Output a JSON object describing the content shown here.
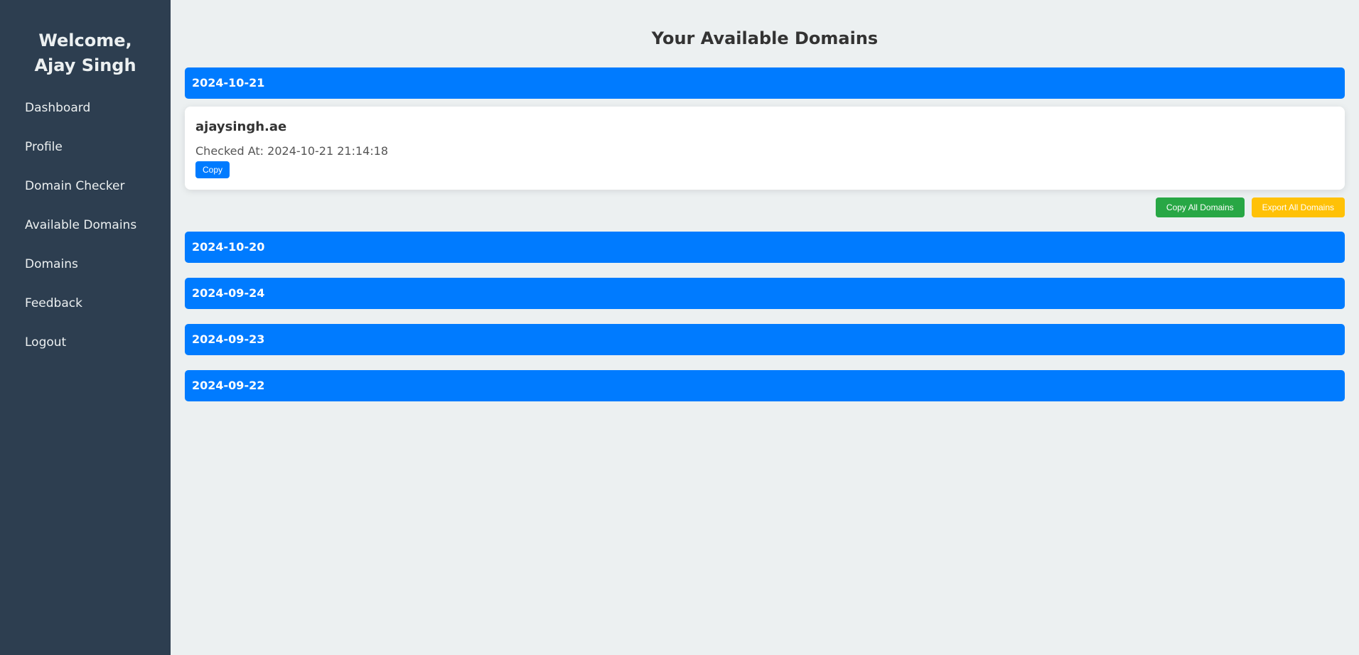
{
  "sidebar": {
    "welcome_line1": "Welcome,",
    "welcome_line2": "Ajay Singh",
    "items": [
      {
        "label": "Dashboard"
      },
      {
        "label": "Profile"
      },
      {
        "label": "Domain Checker"
      },
      {
        "label": "Available Domains"
      },
      {
        "label": "Domains"
      },
      {
        "label": "Feedback"
      },
      {
        "label": "Logout"
      }
    ]
  },
  "main": {
    "title": "Your Available Domains",
    "groups": [
      {
        "date": "2024-10-21",
        "expanded": true,
        "domains": [
          {
            "name": "ajaysingh.ae",
            "checked_at": "Checked At: 2024-10-21 21:14:18",
            "copy_label": "Copy"
          }
        ],
        "copy_all_label": "Copy All Domains",
        "export_all_label": "Export All Domains"
      },
      {
        "date": "2024-10-20",
        "expanded": false
      },
      {
        "date": "2024-09-24",
        "expanded": false
      },
      {
        "date": "2024-09-23",
        "expanded": false
      },
      {
        "date": "2024-09-22",
        "expanded": false
      }
    ]
  },
  "colors": {
    "sidebar_bg": "#2d3e50",
    "page_bg": "#ecf0f1",
    "primary": "#007bff",
    "success": "#28a745",
    "warning": "#ffc107"
  }
}
